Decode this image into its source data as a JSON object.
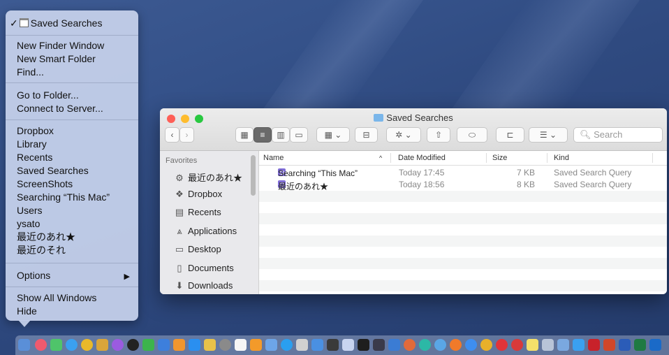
{
  "menu": {
    "checked_window": "Saved Searches",
    "items_group1": [
      "New Finder Window",
      "New Smart Folder",
      "Find..."
    ],
    "items_group2": [
      "Go to Folder...",
      "Connect to Server..."
    ],
    "recent_folders": [
      "Dropbox",
      "Library",
      "Recents",
      "Saved Searches",
      "ScreenShots",
      "Searching “This Mac”",
      "Users",
      "ysato",
      "最近のあれ★",
      "最近のそれ"
    ],
    "options": "Options",
    "show_all_windows": "Show All Windows",
    "hide": "Hide"
  },
  "finder": {
    "title": "Saved Searches",
    "search_placeholder": "Search",
    "sidebar_header": "Favorites",
    "sidebar_items": [
      {
        "label": "最近のあれ★",
        "icon": "gear-icon"
      },
      {
        "label": "Dropbox",
        "icon": "dropbox-icon"
      },
      {
        "label": "Recents",
        "icon": "recents-icon"
      },
      {
        "label": "Applications",
        "icon": "applications-icon"
      },
      {
        "label": "Desktop",
        "icon": "desktop-icon"
      },
      {
        "label": "Documents",
        "icon": "documents-icon"
      },
      {
        "label": "Downloads",
        "icon": "downloads-icon"
      }
    ],
    "columns": {
      "name": "Name",
      "date": "Date Modified",
      "size": "Size",
      "kind": "Kind"
    },
    "rows": [
      {
        "name": "Searching “This Mac”",
        "date": "Today 17:45",
        "size": "7 KB",
        "kind": "Saved Search Query"
      },
      {
        "name": "最近のあれ★",
        "date": "Today 18:56",
        "size": "8 KB",
        "kind": "Saved Search Query"
      }
    ]
  },
  "colors": {
    "selection_accent": "#6a6a6a",
    "menu_background": "#c4d0ea",
    "desktop": "#2f4a80"
  }
}
